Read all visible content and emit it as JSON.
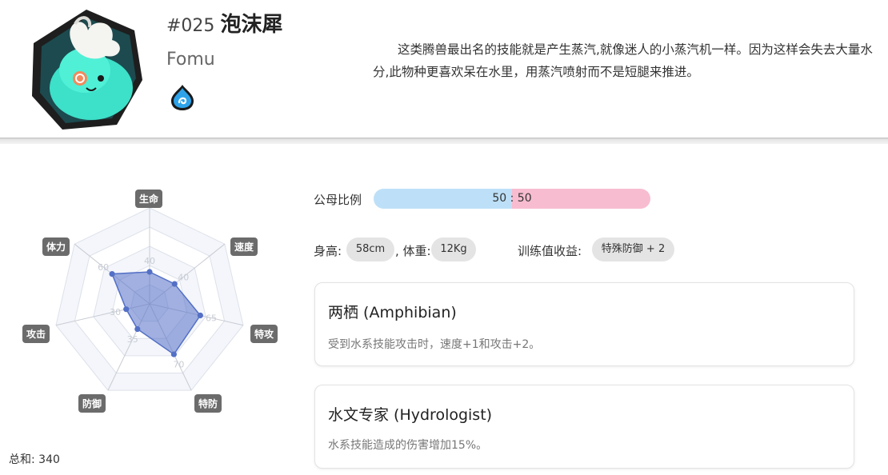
{
  "header": {
    "number": "#025",
    "name": "泡沫犀",
    "english_name": "Fomu",
    "type_icon": "water-element-icon",
    "description": "这类腾兽最出名的技能就是产生蒸汽,就像迷人的小蒸汽机一样。因为这样会失去大量水分,此物种更喜欢呆在水里，用蒸汽喷射而不是短腿来推进。"
  },
  "stats": {
    "labels": {
      "hp": "生命",
      "speed": "速度",
      "sp_atk": "特攻",
      "sp_def": "特防",
      "defense": "防御",
      "attack": "攻击",
      "stamina": "体力"
    },
    "values": {
      "hp": "40",
      "speed": "40",
      "sp_atk": "65",
      "sp_def": "70",
      "defense": "35",
      "attack": "30",
      "stamina": "60"
    },
    "total": "总和: 340"
  },
  "gender": {
    "label": "公母比例",
    "text": "50 : 50",
    "male_percent": 50,
    "female_percent": 50,
    "male_color": "#bde0f8",
    "female_color": "#f8bcd0"
  },
  "physical": {
    "height_label": "身高:",
    "height": "58cm",
    "weight_label": ", 体重:",
    "weight": "12Kg",
    "ev_label": "训练值收益:",
    "ev_value": "特殊防御 + 2"
  },
  "abilities": [
    {
      "name": "两栖 (Amphibian)",
      "description": "受到水系技能攻击时，速度+1和攻击+2。"
    },
    {
      "name": "水文专家 (Hydrologist)",
      "description": "水系技能造成的伤害增加15%。"
    }
  ],
  "colors": {
    "stat_point": "#5470c6",
    "stat_badge": "#6b6b6b",
    "water_icon": "#2ea3ea"
  }
}
